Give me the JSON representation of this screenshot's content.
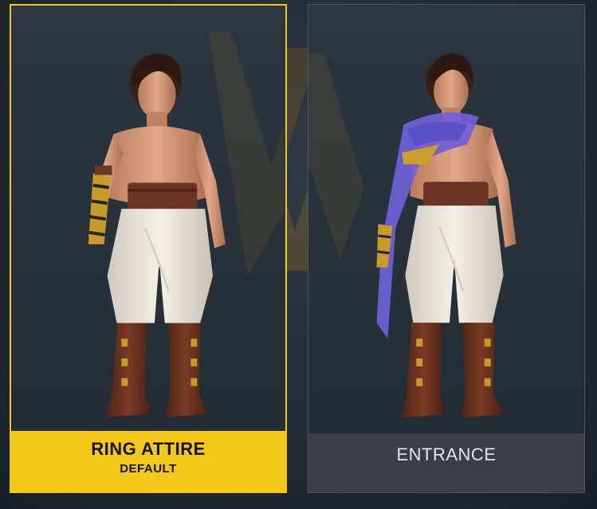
{
  "screen": {
    "background_color": "#232b33"
  },
  "cards": [
    {
      "title": "RING ATTIRE",
      "subtitle": "DEFAULT",
      "selected": true,
      "accent": "#f4c81b",
      "has_cape": false
    },
    {
      "title": "ENTRANCE",
      "subtitle": "",
      "selected": false,
      "accent": "#3b3e43",
      "has_cape": true,
      "cape_color": "#7060d8"
    }
  ]
}
